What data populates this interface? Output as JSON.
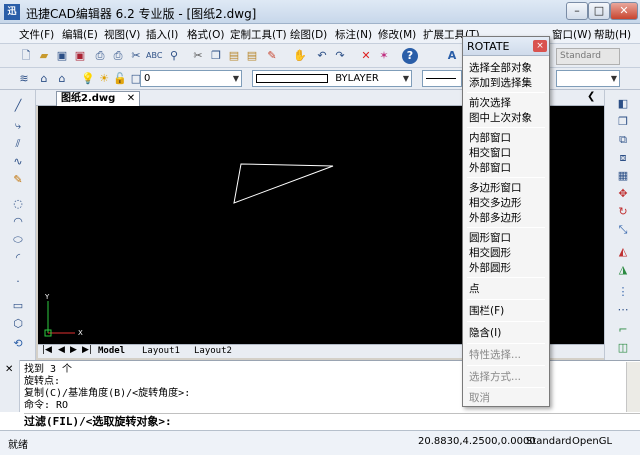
{
  "window": {
    "title": "迅捷CAD编辑器 6.2 专业版 - [图纸2.dwg]",
    "app_icon": "迅"
  },
  "menubar": {
    "items": [
      "文件(F)",
      "编辑(E)",
      "视图(V)",
      "插入(I)",
      "格式(O)",
      "定制工具(T)",
      "绘图(D)",
      "标注(N)",
      "修改(M)",
      "扩展工具(T)",
      "窗口(W)",
      "帮助(H)"
    ]
  },
  "toolbar2": {
    "layer_value": "0",
    "linetype_value": "BYLAYER",
    "standard_label": "Standard"
  },
  "document": {
    "tab_label": "图纸2.dwg",
    "layout_tabs": [
      "Model",
      "Layout1",
      "Layout2"
    ],
    "ucs_x": "X",
    "ucs_y": "Y"
  },
  "command": {
    "lines": [
      "找到 3 个",
      "旋转点:",
      "复制(C)/基准角度(B)/<旋转角度>:",
      "命令: RO"
    ],
    "prompt": "过滤(FIL)/<选取旋转对象>:"
  },
  "status": {
    "ready": "就绪",
    "coordinates": "20.8830,4.2500,0.0000",
    "style": "Standard",
    "renderer": "OpenGL"
  },
  "context_menu": {
    "title": "ROTATE",
    "close": "×",
    "groups": [
      [
        "选择全部对象",
        "添加到选择集"
      ],
      [
        "前次选择",
        "图中上次对象"
      ],
      [
        "内部窗口",
        "相交窗口",
        "外部窗口"
      ],
      [
        "多边形窗口",
        "相交多边形",
        "外部多边形"
      ],
      [
        "圆形窗口",
        "相交圆形",
        "外部圆形"
      ],
      [
        "点"
      ],
      [
        "围栏(F)"
      ],
      [
        "隐含(I)"
      ],
      [
        "特性选择..."
      ],
      [
        "选择方式..."
      ],
      [
        "取消"
      ]
    ]
  },
  "colors": {
    "canvas": "#000000",
    "accent": "#2a5ea8"
  }
}
